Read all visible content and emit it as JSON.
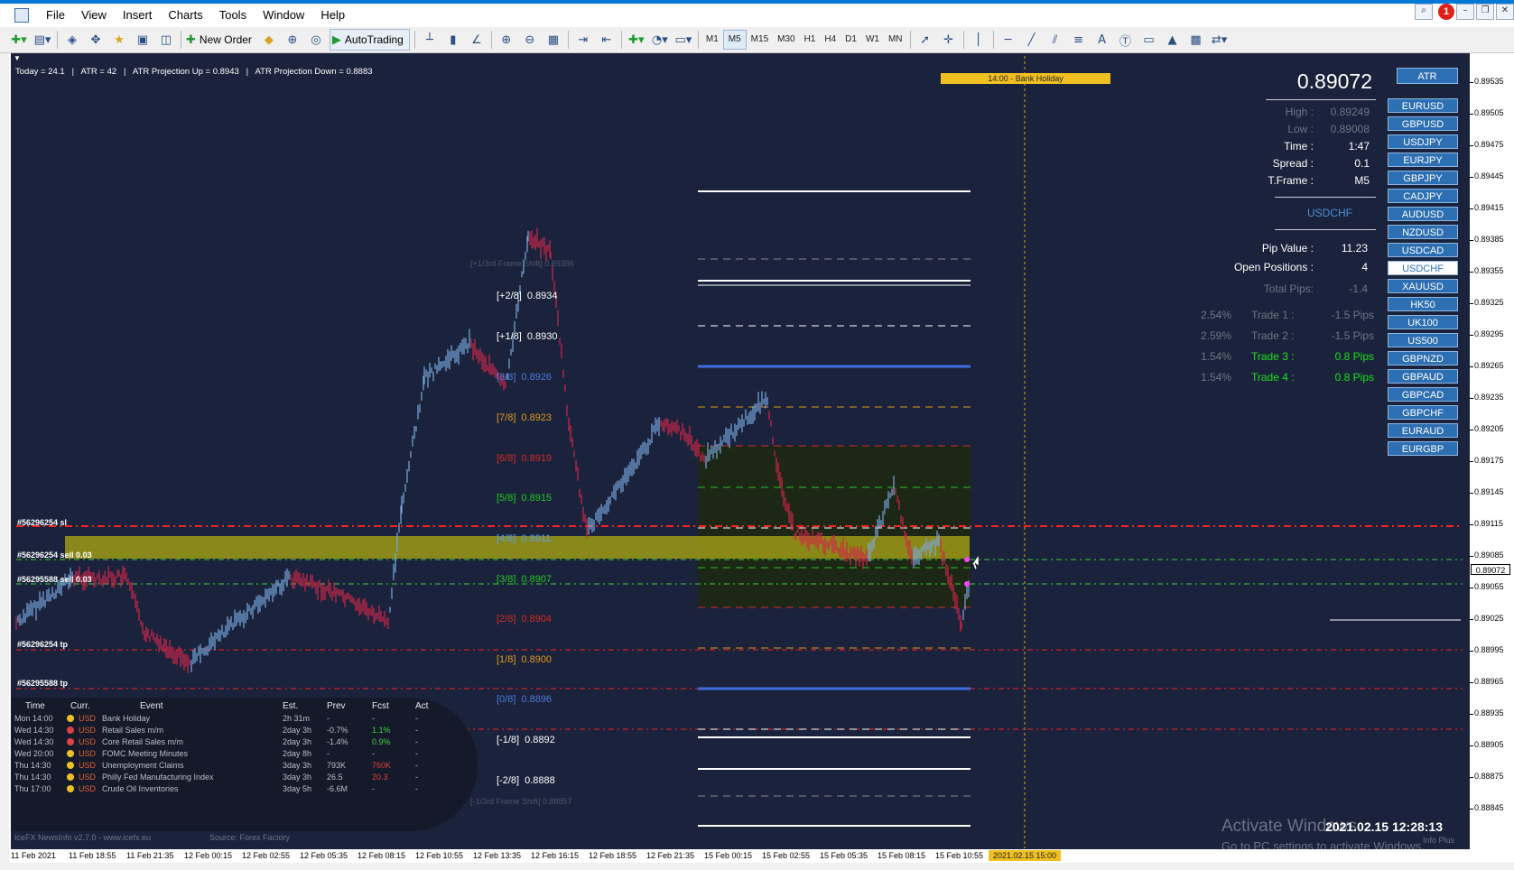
{
  "menu": [
    "File",
    "View",
    "Insert",
    "Charts",
    "Tools",
    "Window",
    "Help"
  ],
  "toolbar": {
    "new_order": "New Order",
    "autotrading": "AutoTrading",
    "timeframes": [
      "M1",
      "M5",
      "M15",
      "M30",
      "H1",
      "H4",
      "D1",
      "W1",
      "MN"
    ],
    "active_tf": "M5"
  },
  "notifications": "1",
  "header_text": "Today = 24.1   |   ATR = 42   |   ATR Projection Up = 0.8943   |   ATR Projection Down = 0.8883",
  "event_banner": "14:00 - Bank Holiday",
  "price_big": "0.89072",
  "atr_button": "ATR",
  "info": [
    {
      "label": "High :",
      "value": "0.89249"
    },
    {
      "label": "Low :",
      "value": "0.89008"
    },
    {
      "label": "Time :",
      "value": "1:47"
    },
    {
      "label": "Spread :",
      "value": "0.1"
    },
    {
      "label": "T.Frame :",
      "value": "M5"
    }
  ],
  "symbol": "USDCHF",
  "pip_value": {
    "label": "Pip Value :",
    "value": "11.23"
  },
  "open_positions": {
    "label": "Open Positions :",
    "value": "4"
  },
  "total_pips": {
    "label": "Total Pips:",
    "value": "-1.4"
  },
  "trades": [
    {
      "pct": "2.54%",
      "label": "Trade 1 :",
      "value": "-1.5 Pips",
      "color": "#6e7583"
    },
    {
      "pct": "2.59%",
      "label": "Trade 2 :",
      "value": "-1.5 Pips",
      "color": "#6e7583"
    },
    {
      "pct": "1.54%",
      "label": "Trade 3 :",
      "value": "0.8 Pips",
      "color": "#1ee01e"
    },
    {
      "pct": "1.54%",
      "label": "Trade 4 :",
      "value": "0.8 Pips",
      "color": "#1ee01e"
    }
  ],
  "symbol_buttons": [
    "EURUSD",
    "GBPUSD",
    "USDJPY",
    "EURJPY",
    "GBPJPY",
    "CADJPY",
    "AUDUSD",
    "NZDUSD",
    "USDCAD",
    "USDCHF",
    "XAUUSD",
    "HK50",
    "UK100",
    "US500",
    "GBPNZD",
    "GBPAUD",
    "GBPCAD",
    "GBPCHF",
    "EURAUD",
    "EURGBP"
  ],
  "selected_symbol": "USDCHF",
  "murrey_levels": [
    {
      "label": "[+2/8]",
      "price": "0.8934",
      "color": "#ffffff"
    },
    {
      "label": "[+1/8]",
      "price": "0.8930",
      "color": "#ffffff"
    },
    {
      "label": "[8/8]",
      "price": "0.8926",
      "color": "#4f78d9"
    },
    {
      "label": "[7/8]",
      "price": "0.8923",
      "color": "#e09a1c"
    },
    {
      "label": "[6/8]",
      "price": "0.8919",
      "color": "#d62828"
    },
    {
      "label": "[5/8]",
      "price": "0.8915",
      "color": "#22c922"
    },
    {
      "label": "[4/8]",
      "price": "0.8911",
      "color": "#5aa0e8"
    },
    {
      "label": "[3/8]",
      "price": "0.8907",
      "color": "#22c922"
    },
    {
      "label": "[2/8]",
      "price": "0.8904",
      "color": "#d62828"
    },
    {
      "label": "[1/8]",
      "price": "0.8900",
      "color": "#e09a1c"
    },
    {
      "label": "[0/8]",
      "price": "0.8896",
      "color": "#4f78d9"
    },
    {
      "label": "[-1/8]",
      "price": "0.8892",
      "color": "#ffffff"
    },
    {
      "label": "[-2/8]",
      "price": "0.8888",
      "color": "#ffffff"
    }
  ],
  "frame_shift_up": "[+1/3rd Frame Shift]  0.89386",
  "frame_shift_down": "[-1/3rd Frame Shift]  0.88857",
  "orders": [
    "#56296254 sl",
    "#56296254 sell 0.03",
    "#56295588 sell 0.03",
    "#56296254 tp",
    "#56295588 tp"
  ],
  "price_axis": [
    "0.89535",
    "0.89505",
    "0.89475",
    "0.89445",
    "0.89415",
    "0.89385",
    "0.89355",
    "0.89325",
    "0.89295",
    "0.89265",
    "0.89235",
    "0.89205",
    "0.89175",
    "0.89145",
    "0.89115",
    "0.89085",
    "0.89055",
    "0.89025",
    "0.88995",
    "0.88965",
    "0.88935",
    "0.88905",
    "0.88875",
    "0.88845"
  ],
  "current_price_tag": "0.89072",
  "time_axis": [
    "11 Feb 2021",
    "11 Feb 18:55",
    "11 Feb 21:35",
    "12 Feb 00:15",
    "12 Feb 02:55",
    "12 Feb 05:35",
    "12 Feb 08:15",
    "12 Feb 10:55",
    "12 Feb 13:35",
    "12 Feb 16:15",
    "12 Feb 18:55",
    "12 Feb 21:35",
    "15 Feb 00:15",
    "15 Feb 02:55",
    "15 Feb 05:35",
    "15 Feb 08:15",
    "15 Feb 10:55"
  ],
  "time_highlight": "2021.02.15 15:00",
  "news": {
    "headers": [
      "Time",
      "Curr.",
      "Event",
      "Est.",
      "Prev",
      "Fcst",
      "Act"
    ],
    "rows": [
      {
        "time": "Mon 14:00",
        "dot": "#f0c020",
        "curr": "USD",
        "event": "Bank Holiday",
        "est": "2h 31m",
        "prev": "-",
        "fcst": "-",
        "act": "-",
        "fcolor": "#b9bec8"
      },
      {
        "time": "Wed 14:30",
        "dot": "#e04040",
        "curr": "USD",
        "event": "Retail Sales m/m",
        "est": "2day 3h",
        "prev": "-0.7%",
        "fcst": "1.1%",
        "act": "-",
        "fcolor": "#46d046"
      },
      {
        "time": "Wed 14:30",
        "dot": "#e04040",
        "curr": "USD",
        "event": "Core Retail Sales m/m",
        "est": "2day 3h",
        "prev": "-1.4%",
        "fcst": "0.9%",
        "act": "-",
        "fcolor": "#46d046"
      },
      {
        "time": "Wed 20:00",
        "dot": "#f0c020",
        "curr": "USD",
        "event": "FOMC Meeting Minutes",
        "est": "2day 8h",
        "prev": "-",
        "fcst": "-",
        "act": "-",
        "fcolor": "#b9bec8"
      },
      {
        "time": "Thu 14:30",
        "dot": "#f0c020",
        "curr": "USD",
        "event": "Unemployment Claims",
        "est": "3day 3h",
        "prev": "793K",
        "fcst": "760K",
        "act": "-",
        "fcolor": "#e04040"
      },
      {
        "time": "Thu 14:30",
        "dot": "#f0c020",
        "curr": "USD",
        "event": "Philly Fed Manufacturing Index",
        "est": "3day 3h",
        "prev": "26.5",
        "fcst": "20.3",
        "act": "-",
        "fcolor": "#e04040"
      },
      {
        "time": "Thu 17:00",
        "dot": "#f0c020",
        "curr": "USD",
        "event": "Crude Oil Inventories",
        "est": "3day 5h",
        "prev": "-6.6M",
        "fcst": "-",
        "act": "-",
        "fcolor": "#b9bec8"
      }
    ],
    "footer_left": "IceFX NewsInfo v2.7.0  -  www.icefx.eu",
    "footer_right": "Source: Forex Factory"
  },
  "watermark": {
    "line1": "Activate Windows",
    "line2": "Go to PC settings to activate Windows."
  },
  "datetime": "2021.02.15 12:28:13",
  "info_plus": "Info Plus",
  "colors": {
    "chart_bg": "#1a233b",
    "bull": "#7aa9e0",
    "bear": "#d2244a",
    "zone": "#9e9a16"
  }
}
